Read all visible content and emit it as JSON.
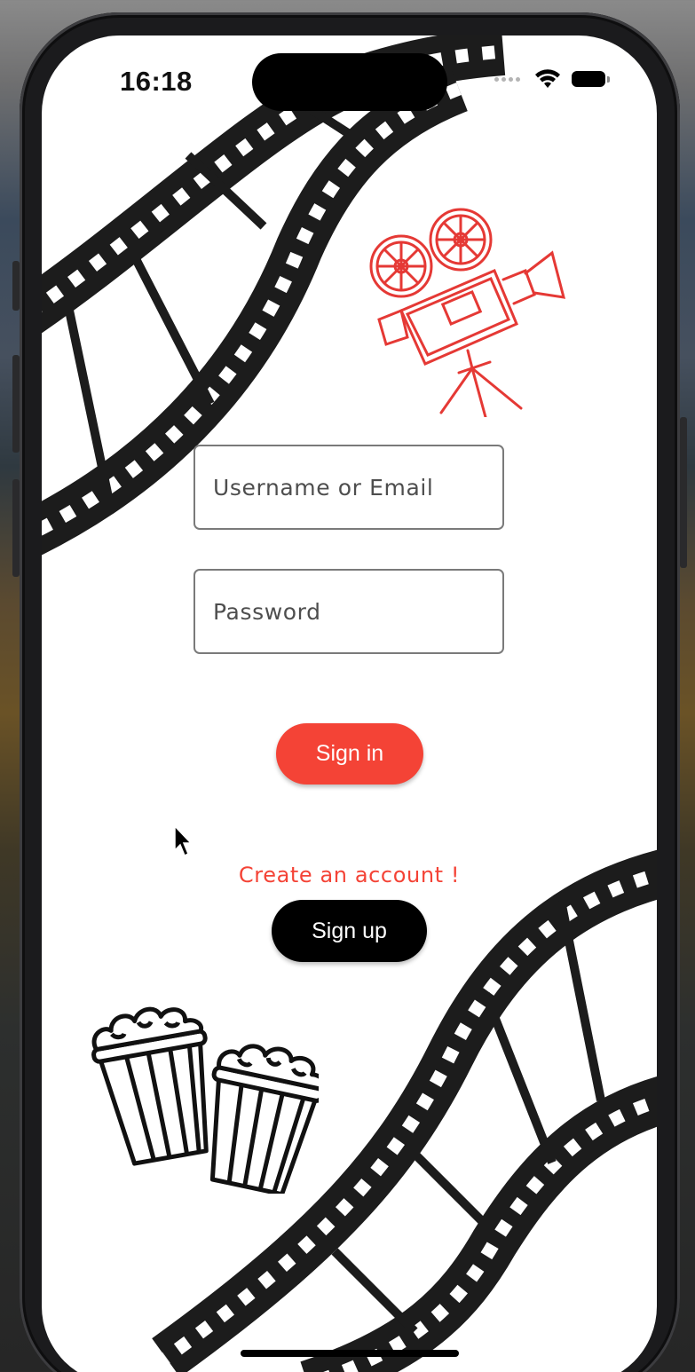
{
  "status_bar": {
    "time": "16:18",
    "icons": [
      "signal-dots-icon",
      "wifi-icon",
      "battery-icon"
    ]
  },
  "login_form": {
    "username_placeholder": "Username or Email",
    "username_value": "",
    "password_placeholder": "Password",
    "password_value": "",
    "signin_label": "Sign in"
  },
  "signup": {
    "prompt": "Create an account !",
    "signup_label": "Sign up"
  },
  "decorations": [
    "film-strip-icon",
    "movie-camera-icon",
    "popcorn-icon"
  ],
  "colors": {
    "accent": "#f44336",
    "secondary_button": "#000000",
    "background": "#ffffff"
  }
}
